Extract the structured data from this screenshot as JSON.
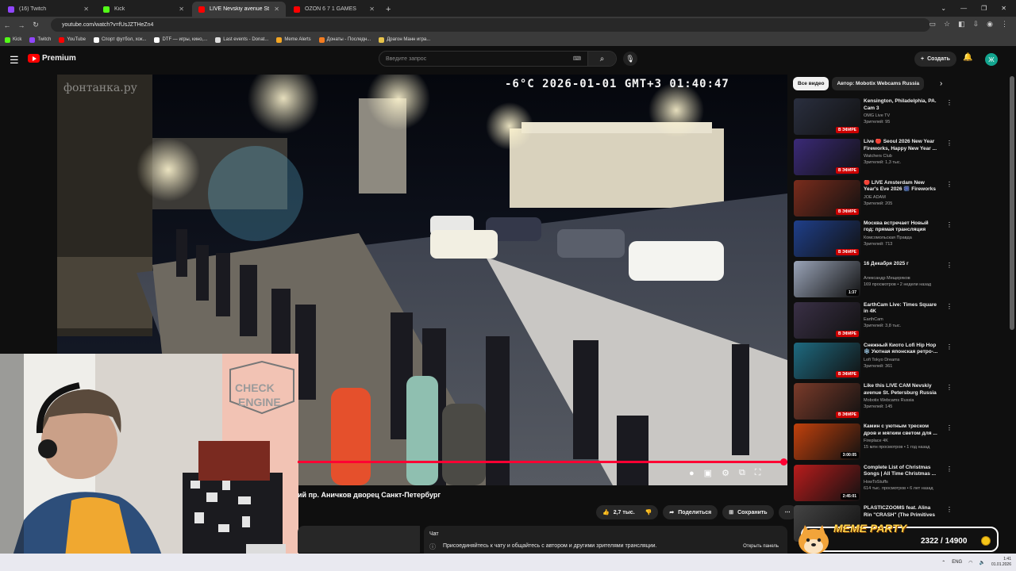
{
  "browser": {
    "tabs": [
      {
        "title": "(16) Twitch",
        "color": "#9146ff",
        "active": false
      },
      {
        "title": "Kick",
        "color": "#53fc18",
        "active": false
      },
      {
        "title": "LIVE Nevskiy avenue St. Pe",
        "color": "#ff0000",
        "active": true
      },
      {
        "title": "OZON 6 7 1 GAMES",
        "color": "#ff0000",
        "active": false
      }
    ],
    "new_tab": "+",
    "url": "youtube.com/watch?v=fUsJZTHeZn4",
    "bookmarks": [
      {
        "label": "Kick",
        "color": "#53fc18"
      },
      {
        "label": "Twitch",
        "color": "#9146ff"
      },
      {
        "label": "YouTube",
        "color": "#ff0000"
      },
      {
        "label": "Спорт футбол, хок...",
        "color": "#ffffff"
      },
      {
        "label": "DTF — игры, кино,...",
        "color": "#ffffff"
      },
      {
        "label": "Last events - Donat...",
        "color": "#dddddd"
      },
      {
        "label": "Meme Alerts",
        "color": "#f4a623"
      },
      {
        "label": "Донаты - Последн...",
        "color": "#f47c20"
      },
      {
        "label": "Драгон Манн игра...",
        "color": "#e8c34a"
      }
    ]
  },
  "youtube": {
    "logo": "Premium",
    "search_placeholder": "Введите запрос",
    "create_label": "Создать",
    "avatar_letter": "Ж"
  },
  "video": {
    "osd": "-6°C  2026-01-01 GMT+3 01:40:47",
    "watermark": "фонтанка.ру",
    "title": "ий пр. Аничков дворец Санкт-Петербург",
    "likes": "2,7 тыс.",
    "share": "Поделиться",
    "save": "Сохранить",
    "progress": 1.0
  },
  "chat": {
    "header": "Чат",
    "message": "Присоединяйтесь к чату и общайтесь с автором и другими зрителями трансляции.",
    "open": "Открыть панель"
  },
  "chips": [
    "Все видео",
    "Автор: Mobotix Webcams Russia"
  ],
  "recommendations": [
    {
      "title": "Kensington, Philadelphia, PA. Cam 3",
      "channel": "OMG Live TV",
      "views": "Зрителей: 95",
      "badge": "В ЭФИРЕ",
      "live": true,
      "thumb": "#2a2f3f"
    },
    {
      "title": "Live 🔴 Seoul 2026 New Year Fireworks, Happy New Year ...",
      "channel": "Watchers Club",
      "views": "Зрителей: 1,3 тыс.",
      "badge": "В ЭФИРЕ",
      "live": true,
      "thumb": "#3b2a78"
    },
    {
      "title": "🔴 LIVE Amsterdam New Year's Eve 2026 🎆 Fireworks Walk",
      "channel": "JOE ADAM",
      "views": "Зрителей: 205",
      "badge": "В ЭФИРЕ",
      "live": true,
      "thumb": "#7a2c1c"
    },
    {
      "title": "Москва встречает Новый год: прямая трансляция",
      "channel": "Комсомольская Правда",
      "views": "Зрителей: 713",
      "badge": "В ЭФИРЕ",
      "live": true,
      "thumb": "#1f3f8a"
    },
    {
      "title": "16 Декабря 2025 г",
      "channel": "Александр Мещеряков",
      "views": "169 просмотров • 2 недели назад",
      "badge": "1:37",
      "live": false,
      "thumb": "#9aa4b8"
    },
    {
      "title": "EarthCam Live: Times Square in 4K",
      "channel": "EarthCam",
      "views": "Зрителей: 3,8 тыс.",
      "badge": "В ЭФИРЕ",
      "live": true,
      "thumb": "#3a3046"
    },
    {
      "title": "Снежный Киото Lofi Hip Hop ❄️ Уютная японская ретро-...",
      "channel": "Lofi Tokyo Dreams",
      "views": "Зрителей: 361",
      "badge": "В ЭФИРЕ",
      "live": true,
      "thumb": "#1e6a80"
    },
    {
      "title": "Like this LIVE CAM Nevskiy avenue St. Petersburg Russia ...",
      "channel": "Mobotix Webcams Russia",
      "views": "Зрителей: 145",
      "badge": "В ЭФИРЕ",
      "live": true,
      "thumb": "#7b3b2a"
    },
    {
      "title": "Камин с уютным треском дров и мягким светом для ...",
      "channel": "Fireplace 4K",
      "views": "15 млн просмотров • 1 год назад",
      "badge": "3:00:05",
      "live": false,
      "thumb": "#c2410c"
    },
    {
      "title": "Complete List of Christmas Songs | All Time Christmas ...",
      "channel": "HowToStuffs",
      "views": "614 тыс. просмотров • 6 лет назад",
      "badge": "2:45:01",
      "live": false,
      "thumb": "#b91c1c"
    },
    {
      "title": "PLASTICZOOMS feat. Alina Rin \"CRASH\" (The Primitives Cover)",
      "channel": "",
      "views": "",
      "badge": "",
      "live": false,
      "thumb": "#444444"
    }
  ],
  "overlay": {
    "title": "MEME PARTY",
    "count": "2322 / 14900"
  },
  "taskbar": {
    "lang": "ENG",
    "time": "1:41",
    "date": "01.01.2026"
  },
  "icons": {
    "home": "⌂",
    "search": "search-icon",
    "mic": "mic-icon",
    "bell": "bell-icon"
  }
}
